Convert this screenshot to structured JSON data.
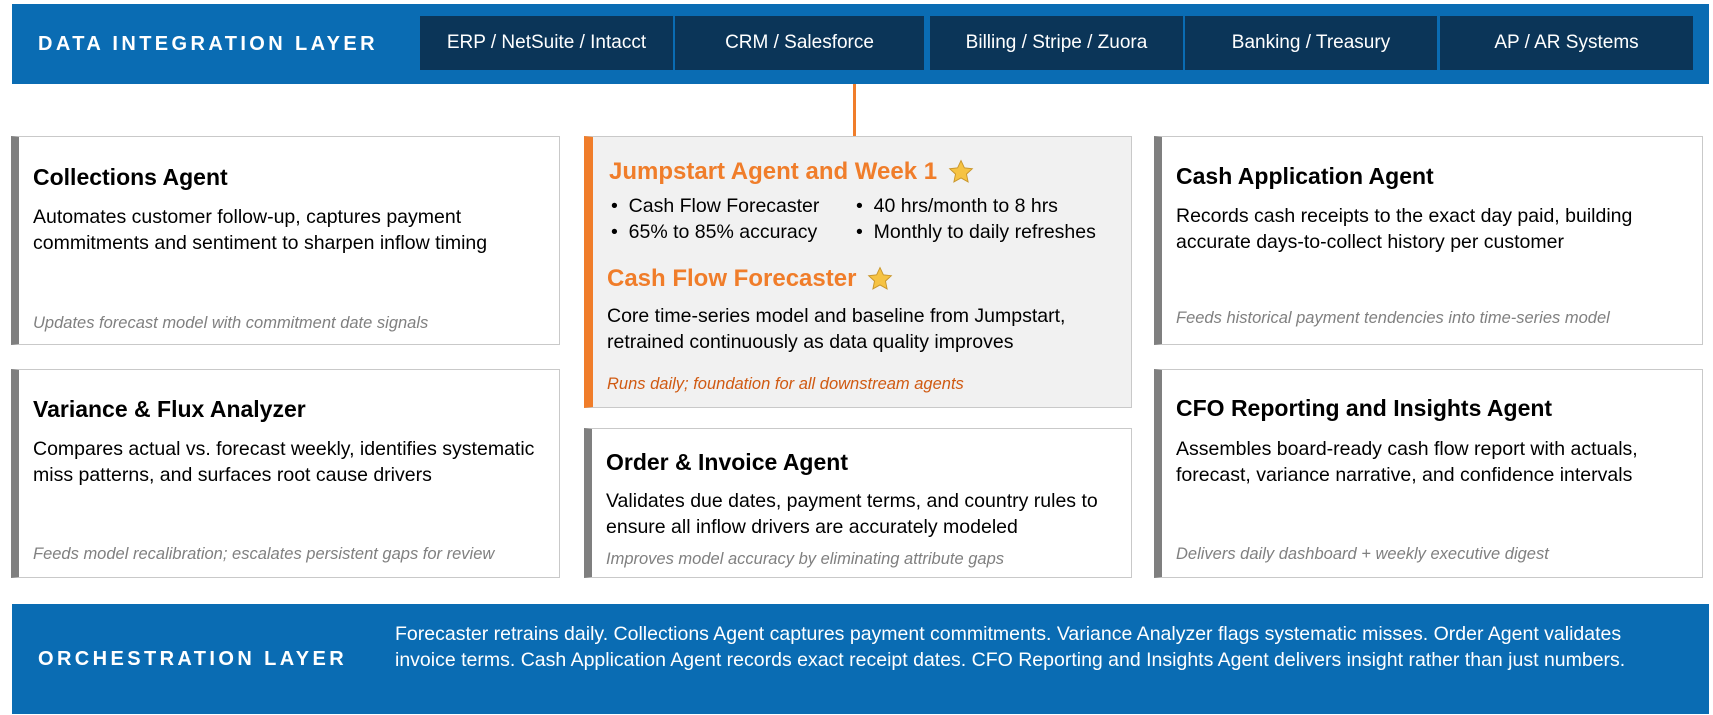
{
  "integration": {
    "title": "DATA INTEGRATION LAYER",
    "sources": [
      "ERP / NetSuite / Intacct",
      "CRM / Salesforce",
      "Billing / Stripe / Zuora",
      "Banking / Treasury",
      "AP / AR Systems"
    ]
  },
  "agents": {
    "collections": {
      "title": "Collections Agent",
      "description": "Automates customer follow-up, captures payment commitments and sentiment to sharpen inflow timing",
      "note": "Updates forecast model with commitment date signals"
    },
    "variance": {
      "title": "Variance & Flux Analyzer",
      "description": "Compares actual vs. forecast weekly, identifies systematic miss patterns, and surfaces root cause drivers",
      "note": "Feeds model recalibration; escalates persistent gaps for review"
    },
    "jumpstart": {
      "title": "Jumpstart Agent and Week 1",
      "icon": "star-icon",
      "bullets": [
        "Cash Flow Forecaster",
        "40 hrs/month to 8 hrs",
        "65% to 85% accuracy",
        "Monthly to daily refreshes"
      ],
      "forecaster_title": "Cash Flow Forecaster",
      "forecaster_description": "Core time-series model and baseline from Jumpstart, retrained continuously as data quality improves",
      "note": "Runs daily; foundation for all downstream agents"
    },
    "order_invoice": {
      "title": "Order & Invoice Agent",
      "description": "Validates due dates, payment terms, and country rules to ensure all inflow drivers are accurately modeled",
      "note": "Improves model accuracy by eliminating attribute gaps"
    },
    "cash_application": {
      "title": "Cash Application Agent",
      "description": "Records cash receipts to the exact day paid, building accurate days-to-collect history per customer",
      "note": "Feeds historical payment tendencies into time-series model"
    },
    "cfo_reporting": {
      "title": "CFO Reporting and Insights Agent",
      "description": "Assembles board-ready cash flow report with actuals, forecast, variance narrative, and confidence intervals",
      "note": "Delivers daily dashboard + weekly executive digest"
    }
  },
  "orchestration": {
    "title": "ORCHESTRATION LAYER",
    "summary": "Forecaster retrains daily. Collections Agent captures payment commitments. Variance Analyzer flags systematic misses. Order Agent validates invoice terms. Cash Application Agent records exact receipt dates. CFO Reporting and Insights Agent delivers insight rather than just numbers."
  },
  "colors": {
    "layer_blue": "#0a6cb3",
    "chip_navy": "#0b3558",
    "accent_orange": "#f07d2a",
    "card_border_gray": "#7f7f7f",
    "star_gold": "#f6c343"
  }
}
